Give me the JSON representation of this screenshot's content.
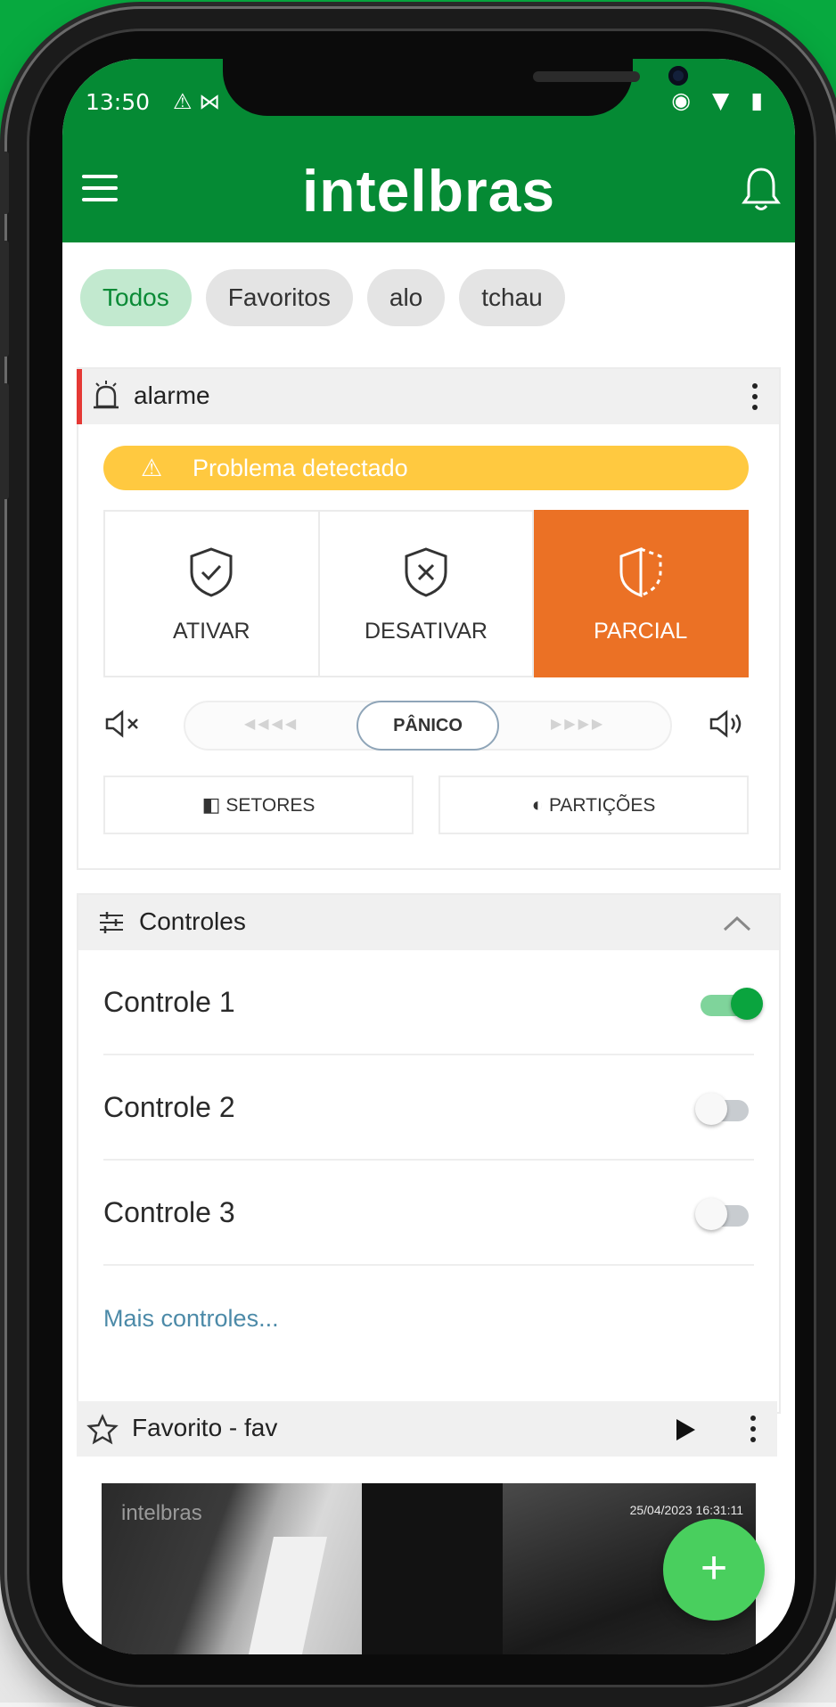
{
  "status_bar": {
    "time": "13:50",
    "left_icons": "⚠ ⋈",
    "right_icons": "◉ ▼ ▮"
  },
  "app_bar": {
    "logo": "intelbras"
  },
  "chips": [
    {
      "label": "Todos",
      "active": true
    },
    {
      "label": "Favoritos",
      "active": false
    },
    {
      "label": "alo",
      "active": false
    },
    {
      "label": "tchau",
      "active": false
    }
  ],
  "alarm_card": {
    "title": "alarme",
    "warning": "Problema detectado",
    "modes": {
      "arm": "ATIVAR",
      "disarm": "DESATIVAR",
      "partial": "PARCIAL"
    },
    "panic_label": "PÂNICO",
    "sectors_label": "SETORES",
    "partitions_label": "PARTIÇÕES",
    "colors": {
      "partial_active": "#eb7125",
      "warning": "#ffc940",
      "alarm_marker": "#e53935"
    }
  },
  "controls": {
    "title": "Controles",
    "items": [
      {
        "label": "Controle 1",
        "on": true
      },
      {
        "label": "Controle 2",
        "on": false
      },
      {
        "label": "Controle 3",
        "on": false
      }
    ],
    "more_link": "Mais controles..."
  },
  "favorite": {
    "title": "Favorito - fav",
    "video_logo": "intelbras",
    "video_timestamp": "25/04/2023 16:31:11"
  },
  "fab_label": "+",
  "colors": {
    "brand_green": "#058a34",
    "background_green": "#07a93f",
    "fab": "#49cf5e"
  }
}
